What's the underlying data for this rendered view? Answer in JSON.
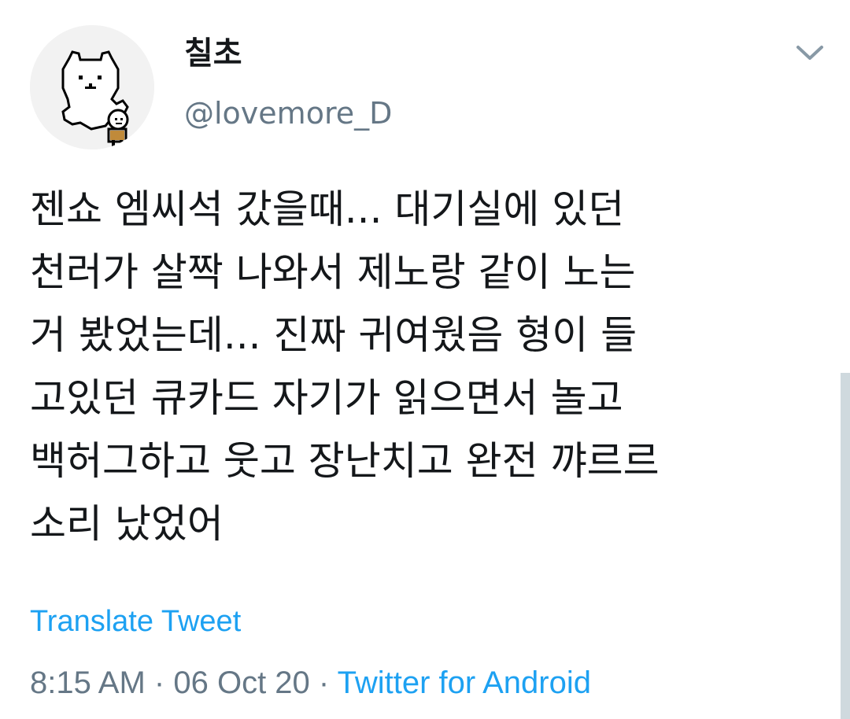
{
  "user": {
    "display_name": "칠초",
    "handle": "@lovemore_D",
    "avatar_icon": "pixel-bear-avatar"
  },
  "menu": {
    "icon": "chevron-down-icon"
  },
  "tweet": {
    "lines": [
      "젠쇼 엠씨석 갔을때... 대기실에 있던",
      "천러가 살짝 나와서 제노랑 같이 노는",
      "거 봤었는데... 진짜 귀여웠음 형이 들",
      "고있던 큐카드 자기가 읽으면서 놀고",
      "백허그하고 웃고 장난치고 완전 꺄르르",
      "소리 났었어"
    ],
    "translate_label": "Translate Tweet"
  },
  "meta": {
    "time": "8:15 AM",
    "separator": "·",
    "date": "06 Oct 20",
    "source": "Twitter for Android"
  },
  "colors": {
    "text": "#14171a",
    "secondary": "#657786",
    "accent": "#1da1f2"
  }
}
